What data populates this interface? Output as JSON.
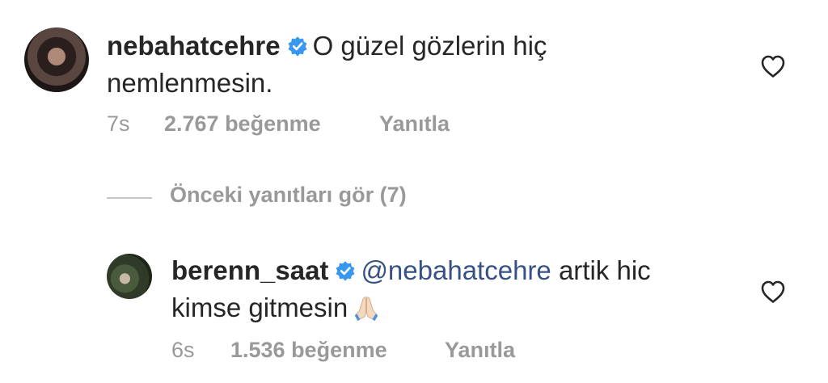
{
  "comments": [
    {
      "username": "nebahatcehre",
      "verified": true,
      "text": "O güzel gözlerin hiç nemlenmesin.",
      "time": "7s",
      "likes": "2.767 beğenme",
      "reply": "Yanıtla",
      "icons": {
        "like": "heart-outline-icon",
        "badge": "verified-badge-icon"
      }
    },
    {
      "username": "berenn_saat",
      "verified": true,
      "mention": "@nebahatcehre",
      "text_line1": "artik hic",
      "text_line2": "kimse gitmesin",
      "emoji": "folded-hands-emoji",
      "time": "6s",
      "likes": "1.536 beğenme",
      "reply": "Yanıtla",
      "icons": {
        "like": "heart-outline-icon",
        "badge": "verified-badge-icon"
      }
    }
  ],
  "replies_toggle": {
    "label": "Önceki yanıtları gör (7)"
  },
  "colors": {
    "text": "#262626",
    "muted": "#999999",
    "mention": "#385185",
    "verified": "#3897f0"
  }
}
